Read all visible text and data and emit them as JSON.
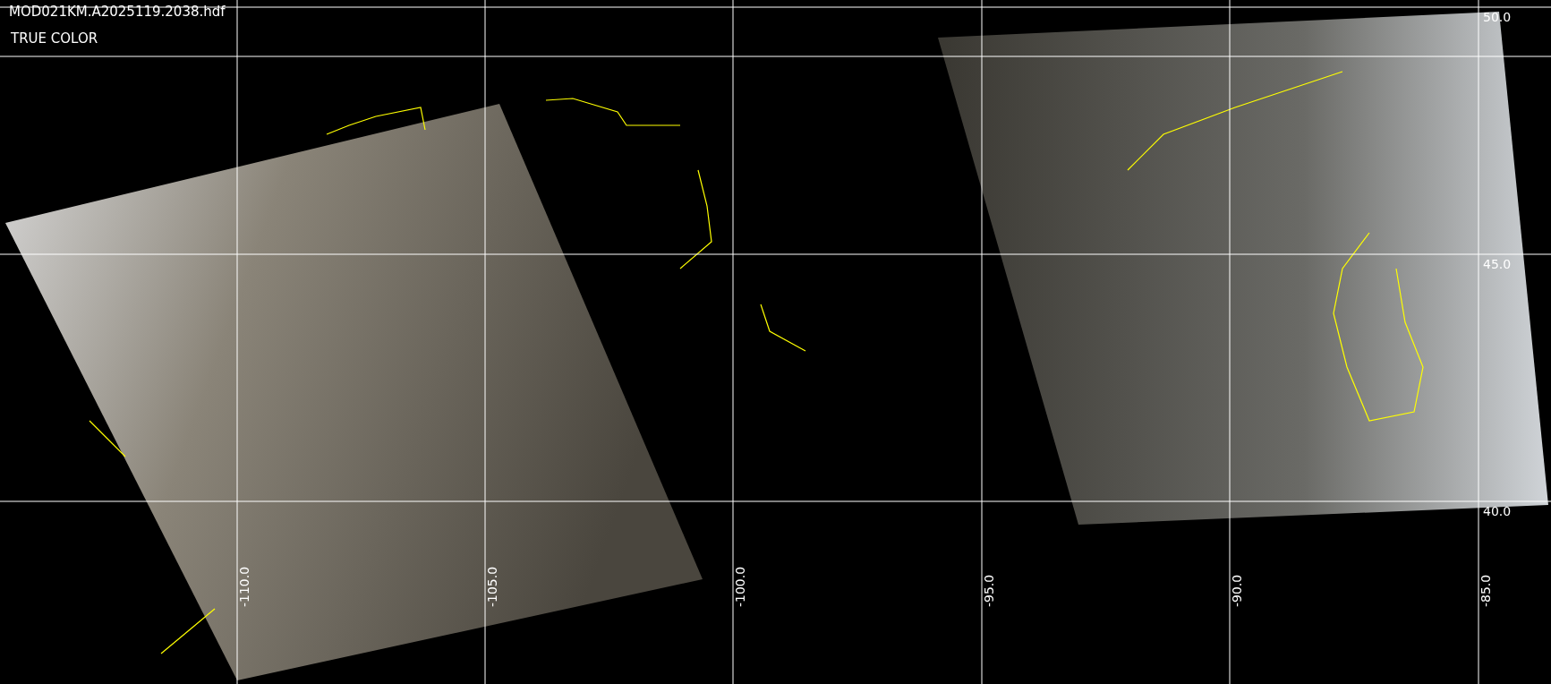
{
  "file_name": "MOD021KM.A2025119.2038.hdf",
  "product": "TRUE COLOR",
  "latitude_labels": [
    "50.0",
    "45.0",
    "40.0"
  ],
  "longitude_labels": [
    "-110.0",
    "-105.0",
    "-100.0",
    "-95.0",
    "-90.0",
    "-85.0"
  ]
}
